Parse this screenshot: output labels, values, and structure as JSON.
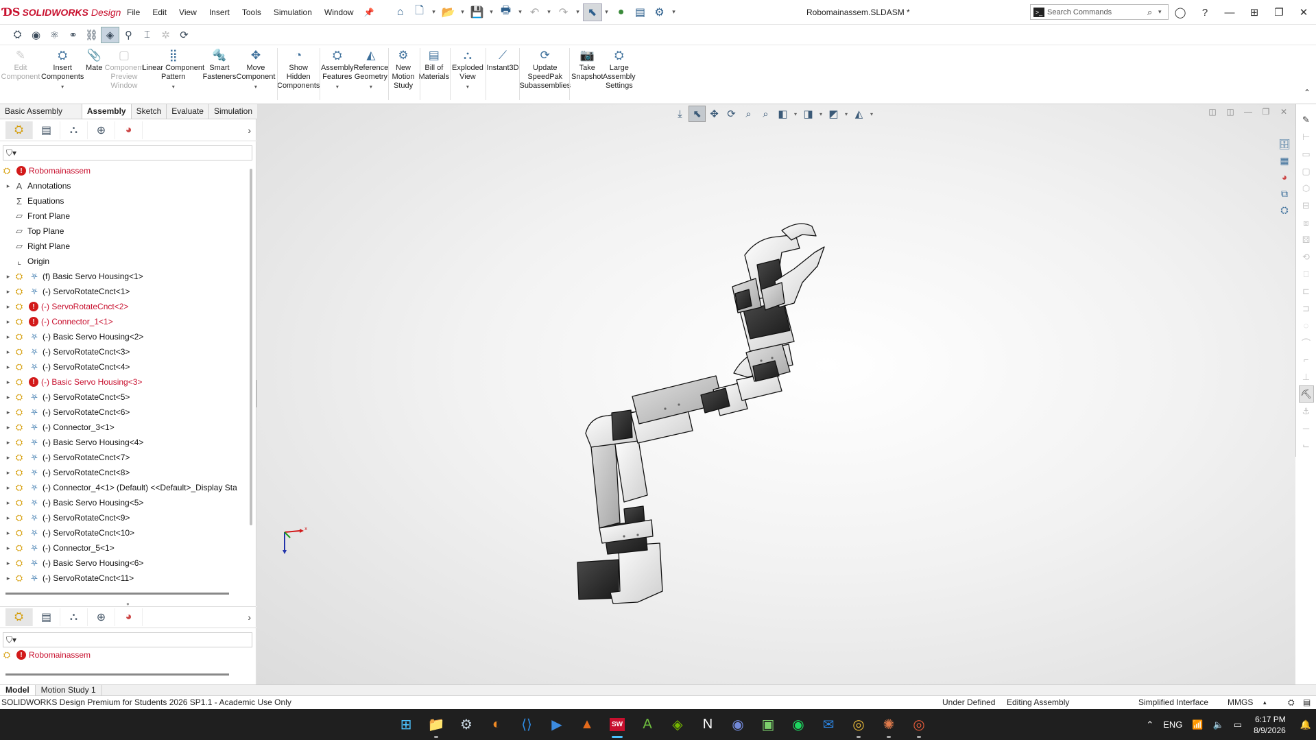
{
  "app": {
    "logo_ds": "ƊS",
    "logo_brand": "SOLIDWORKS",
    "logo_suffix": "Design",
    "document_title": "Robomainassem.SLDASM *"
  },
  "menu": [
    "File",
    "Edit",
    "View",
    "Insert",
    "Tools",
    "Simulation",
    "Window"
  ],
  "search": {
    "placeholder": "Search Commands"
  },
  "ribbon": [
    {
      "label": "Edit\nComponent",
      "icon": "edit-component-icon",
      "disabled": true
    },
    {
      "label": "Insert\nComponents",
      "icon": "insert-components-icon",
      "caret": true
    },
    {
      "label": "Mate",
      "icon": "mate-icon"
    },
    {
      "label": "Component\nPreview\nWindow",
      "icon": "preview-window-icon",
      "disabled": true
    },
    {
      "label": "Linear Component\nPattern",
      "icon": "pattern-icon",
      "caret": true
    },
    {
      "label": "Smart\nFasteners",
      "icon": "fastener-icon"
    },
    {
      "label": "Move\nComponent",
      "icon": "move-component-icon",
      "caret": true
    },
    {
      "label": "Show\nHidden\nComponents",
      "icon": "show-hidden-icon"
    },
    {
      "label": "Assembly\nFeatures",
      "icon": "assembly-features-icon",
      "caret": true
    },
    {
      "label": "Reference\nGeometry",
      "icon": "reference-geometry-icon",
      "caret": true
    },
    {
      "label": "New\nMotion\nStudy",
      "icon": "motion-study-icon"
    },
    {
      "label": "Bill of\nMaterials",
      "icon": "bom-icon"
    },
    {
      "label": "Exploded\nView",
      "icon": "exploded-view-icon",
      "caret": true
    },
    {
      "label": "Instant3D",
      "icon": "instant3d-icon"
    },
    {
      "label": "Update\nSpeedPak\nSubassemblies",
      "icon": "speedpak-icon"
    },
    {
      "label": "Take\nSnapshot",
      "icon": "snapshot-icon"
    },
    {
      "label": "Large\nAssembly\nSettings",
      "icon": "large-assembly-icon"
    }
  ],
  "cm_tabs": [
    "Basic Assembly Tools",
    "Assembly",
    "Sketch",
    "Evaluate",
    "Simulation"
  ],
  "tree": [
    {
      "label": "Robomainassem",
      "type": "root",
      "error": true
    },
    {
      "label": "Annotations",
      "type": "folder",
      "expander": true
    },
    {
      "label": "Equations",
      "type": "equations"
    },
    {
      "label": "Front Plane",
      "type": "plane"
    },
    {
      "label": "Top Plane",
      "type": "plane"
    },
    {
      "label": "Right Plane",
      "type": "plane"
    },
    {
      "label": "Origin",
      "type": "origin"
    },
    {
      "label": "(f) Basic Servo Housing<1>",
      "type": "part",
      "expander": true
    },
    {
      "label": "(-) ServoRotateCnct<1>",
      "type": "part",
      "expander": true
    },
    {
      "label": "(-) ServoRotateCnct<2>",
      "type": "part",
      "expander": true,
      "error": true
    },
    {
      "label": "(-) Connector_1<1>",
      "type": "part",
      "expander": true,
      "error": true
    },
    {
      "label": "(-) Basic Servo Housing<2>",
      "type": "part",
      "expander": true
    },
    {
      "label": "(-) ServoRotateCnct<3>",
      "type": "part",
      "expander": true
    },
    {
      "label": "(-) ServoRotateCnct<4>",
      "type": "part",
      "expander": true
    },
    {
      "label": "(-) Basic Servo Housing<3>",
      "type": "part",
      "expander": true,
      "error": true
    },
    {
      "label": "(-) ServoRotateCnct<5>",
      "type": "part",
      "expander": true
    },
    {
      "label": "(-) ServoRotateCnct<6>",
      "type": "part",
      "expander": true
    },
    {
      "label": "(-) Connector_3<1>",
      "type": "part",
      "expander": true
    },
    {
      "label": "(-) Basic Servo Housing<4>",
      "type": "part",
      "expander": true
    },
    {
      "label": "(-) ServoRotateCnct<7>",
      "type": "part",
      "expander": true
    },
    {
      "label": "(-) ServoRotateCnct<8>",
      "type": "part",
      "expander": true
    },
    {
      "label": "(-) Connector_4<1> (Default) <<Default>_Display Sta",
      "type": "part",
      "expander": true
    },
    {
      "label": "(-) Basic Servo Housing<5>",
      "type": "part",
      "expander": true
    },
    {
      "label": "(-) ServoRotateCnct<9>",
      "type": "part",
      "expander": true
    },
    {
      "label": "(-) ServoRotateCnct<10>",
      "type": "part",
      "expander": true
    },
    {
      "label": "(-) Connector_5<1>",
      "type": "part",
      "expander": true
    },
    {
      "label": "(-) Basic Servo Housing<6>",
      "type": "part",
      "expander": true
    },
    {
      "label": "(-) ServoRotateCnct<11>",
      "type": "part",
      "expander": true
    }
  ],
  "tree2_root": "Robomainassem",
  "model_tabs": [
    "Model",
    "Motion Study 1"
  ],
  "status": {
    "product": "SOLIDWORKS Design Premium for Students 2026 SP1.1 - Academic Use Only",
    "definition": "Under Defined",
    "mode": "Editing Assembly",
    "interface": "Simplified Interface",
    "units": "MMGS"
  },
  "taskbar": {
    "apps": [
      "windows-start-icon",
      "file-explorer-icon",
      "steam-icon",
      "app-icon",
      "vscode-icon",
      "terminal-icon",
      "matlab-icon",
      "solidworks-icon",
      "altium-icon",
      "nvidia-icon",
      "notion-icon",
      "discord-icon",
      "app2-icon",
      "spotify-icon",
      "outlook-icon",
      "chrome-icon",
      "claude-icon",
      "chrome-alt-icon"
    ],
    "language": "ENG",
    "time": "6:17 PM",
    "date": "8/9/2026"
  },
  "colors": {
    "brand_red": "#c8102e",
    "part_yellow": "#d49a00",
    "mate_blue": "#2c6fa8",
    "taskbar_bg": "#1f1f1f"
  }
}
